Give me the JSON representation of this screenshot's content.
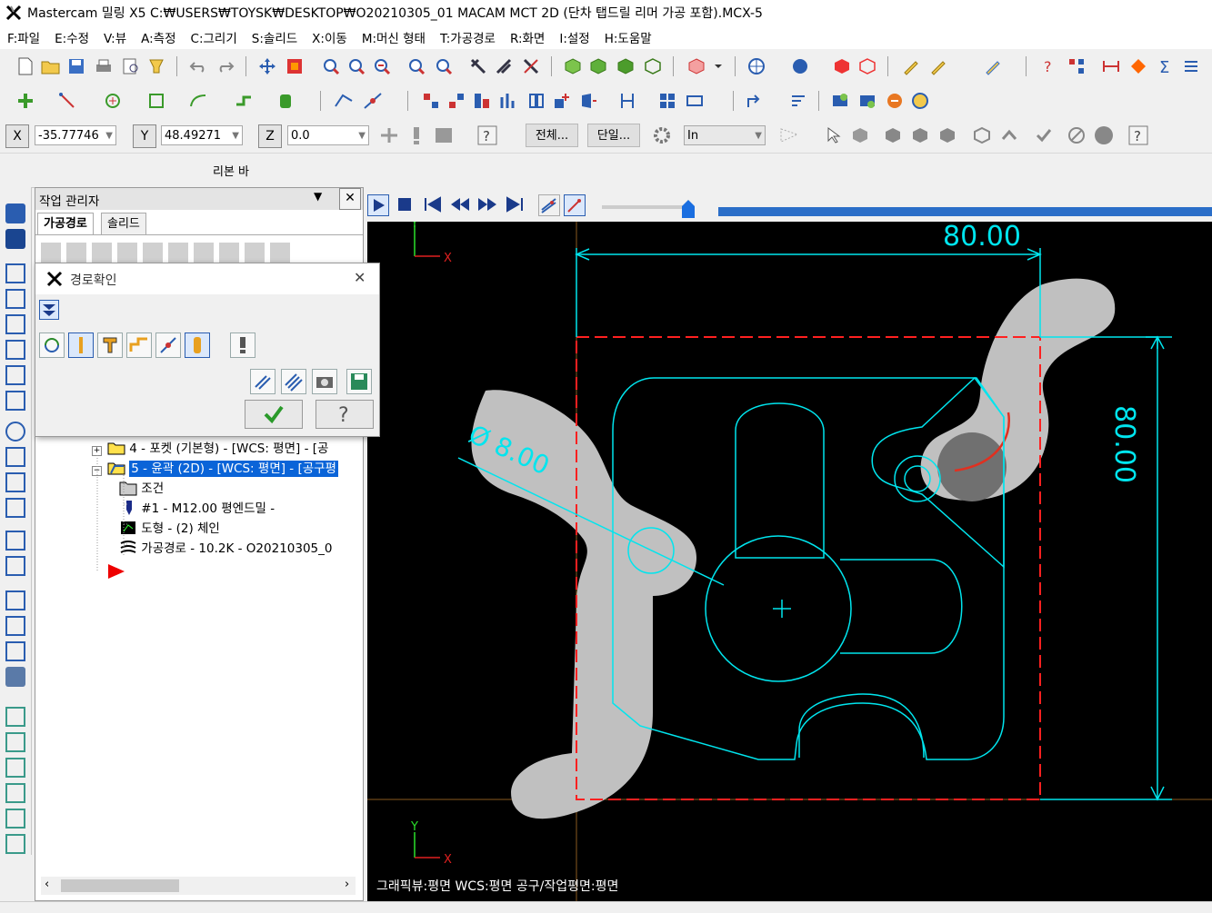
{
  "window": {
    "title": "Mastercam 밀링 X5  C:₩USERS₩TOYSK₩DESKTOP₩O20210305_01 MACAM MCT 2D (단차 탭드릴 리머 가공 포함).MCX-5"
  },
  "menu": [
    "F:파일",
    "E:수정",
    "V:뷰",
    "A:측정",
    "C:그리기",
    "S:솔리드",
    "X:이동",
    "M:머신 형태",
    "T:가공경로",
    "R:화면",
    "I:설정",
    "H:도움말"
  ],
  "coords": {
    "x_label": "X",
    "x_value": "-35.77746",
    "y_label": "Y",
    "y_value": "48.49271",
    "z_label": "Z",
    "z_value": "0.0",
    "all_button": "전체...",
    "single_button": "단일...",
    "level_value": "In"
  },
  "ribbon": {
    "label": "리본 바"
  },
  "ops_manager": {
    "title": "작업 관리자",
    "tabs": [
      "가공경로",
      "솔리드"
    ],
    "tree": [
      {
        "label": "4 - 포켓 (기본형) - [WCS: 평면] - [공"
      },
      {
        "label": "5 - 윤곽 (2D) - [WCS: 평면] - [공구평"
      },
      {
        "label": "조건"
      },
      {
        "label": "#1 - M12.00 평엔드밀 -"
      },
      {
        "label": "도형 - (2) 체인"
      },
      {
        "label": "가공경로 - 10.2K - O20210305_0"
      }
    ]
  },
  "dialog": {
    "title": "경로확인",
    "ok_icon": "checkmark-icon",
    "help_icon": "question-icon"
  },
  "viewport": {
    "dim_horizontal": "80.00",
    "dim_vertical": "80.00",
    "dim_diameter": "Ø 8.00",
    "axis_x": "X",
    "axis_y": "Y",
    "status_text": "그래픽뷰:평면   WCS:평면   공구/작업평면:평면",
    "background": "#000000",
    "geometry_color": "#00e5ee",
    "stock_color": "#c0c0c0",
    "boundary_color": "#ff2020"
  }
}
